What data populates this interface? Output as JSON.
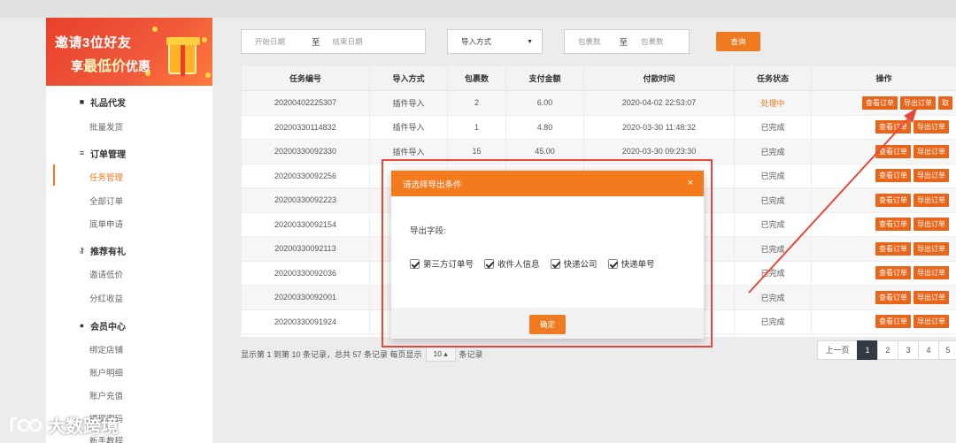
{
  "sidebar": {
    "banner_line1": "邀请3位好友",
    "banner_line2_pre": "享",
    "banner_line2_big": "最低价",
    "banner_line2_post": "优惠",
    "groups": [
      {
        "label": "礼品代发",
        "icon": "gift-icon",
        "items": [
          "批量发货"
        ]
      },
      {
        "label": "订单管理",
        "icon": "list-icon",
        "items": [
          "任务管理",
          "全部订单",
          "底单申请"
        ]
      },
      {
        "label": "推荐有礼",
        "icon": "key-icon",
        "items": [
          "邀请低价",
          "分红收益"
        ]
      },
      {
        "label": "会员中心",
        "icon": "user-icon",
        "items": [
          "绑定店铺",
          "账户明细",
          "账户充值",
          "提现密码",
          "新手教程"
        ]
      }
    ],
    "active_item": "任务管理"
  },
  "filters": {
    "start_date_placeholder": "开始日期",
    "to1": "至",
    "end_date_placeholder": "结束日期",
    "import_method": "导入方式",
    "pkg_min_placeholder": "包裹数",
    "to2": "至",
    "pkg_max_placeholder": "包裹数",
    "search_label": "查询"
  },
  "table": {
    "headers": [
      "任务编号",
      "导入方式",
      "包裹数",
      "支付金额",
      "付款时间",
      "任务状态",
      "操作"
    ],
    "rows": [
      {
        "id": "20200402225307",
        "method": "插件导入",
        "pkgs": "2",
        "amount": "6.00",
        "time": "2020-04-02 22:53:07",
        "status": "处理中"
      },
      {
        "id": "20200330114832",
        "method": "插件导入",
        "pkgs": "1",
        "amount": "4.80",
        "time": "2020-03-30 11:48:32",
        "status": "已完成"
      },
      {
        "id": "20200330092330",
        "method": "插件导入",
        "pkgs": "15",
        "amount": "45.00",
        "time": "2020-03-30 09:23:30",
        "status": "已完成"
      },
      {
        "id": "20200330092256",
        "method": "",
        "pkgs": "",
        "amount": "",
        "time": "",
        "status": "已完成"
      },
      {
        "id": "20200330092223",
        "method": "",
        "pkgs": "",
        "amount": "",
        "time": "",
        "status": "已完成"
      },
      {
        "id": "20200330092154",
        "method": "",
        "pkgs": "",
        "amount": "",
        "time": "",
        "status": "已完成"
      },
      {
        "id": "20200330092113",
        "method": "",
        "pkgs": "",
        "amount": "",
        "time": "",
        "status": "已完成"
      },
      {
        "id": "20200330092036",
        "method": "",
        "pkgs": "",
        "amount": "",
        "time": "",
        "status": "已完成"
      },
      {
        "id": "20200330092001",
        "method": "",
        "pkgs": "",
        "amount": "",
        "time": "",
        "status": "已完成"
      },
      {
        "id": "20200330091924",
        "method": "",
        "pkgs": "",
        "amount": "",
        "time": "",
        "status": "已完成"
      }
    ],
    "op_view": "查看订单",
    "op_export": "导出订单",
    "op_third_partial": "取"
  },
  "footer": {
    "info_pre": "显示第 1 到第 10 条记录，总共 57 条记录  每页显示",
    "per_page": "10",
    "info_post": "条记录",
    "prev": "上一页",
    "pages": [
      "1",
      "2",
      "3",
      "4",
      "5"
    ],
    "current_page": "1"
  },
  "modal": {
    "title": "请选择导出条件",
    "close": "×",
    "field_label": "导出字段:",
    "options": [
      "第三方订单号",
      "收件人信息",
      "快递公司",
      "快递单号"
    ],
    "ok": "确定"
  },
  "watermark": "大数跨境",
  "colors": {
    "accent": "#f07a20",
    "annotation": "#e8473c",
    "banner": "#e8402a"
  }
}
